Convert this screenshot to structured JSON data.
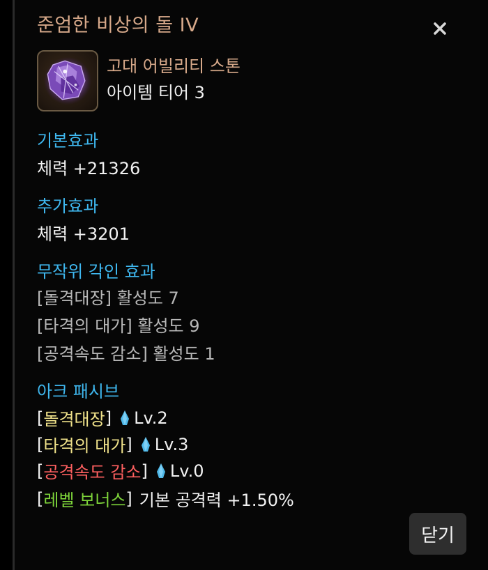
{
  "title": "준엄한 비상의 돌 IV",
  "colors": {
    "title": "#d7a98a",
    "section": "#3fb8f0",
    "engrave_yellow": "#f0e28a",
    "engrave_red": "#ff6060",
    "bonus_green": "#7ed43a",
    "gem": "#4fb8e8"
  },
  "icons": {
    "close": "close-icon",
    "item": "ability-stone-icon",
    "gem": "gem-icon"
  },
  "item": {
    "type": "고대 어빌리티 스톤",
    "tier": "아이템 티어 3"
  },
  "basic_effect": {
    "heading": "기본효과",
    "value": "체력 +21326"
  },
  "extra_effect": {
    "heading": "추가효과",
    "value": "체력 +3201"
  },
  "random_engraving": {
    "heading": "무작위 각인 효과",
    "lines": [
      "[돌격대장] 활성도 7",
      "[타격의 대가] 활성도 9",
      "[공격속도 감소] 활성도 1"
    ]
  },
  "ark_passive": {
    "heading": "아크 패시브",
    "entries": [
      {
        "name": "돌격대장",
        "level": "Lv.2"
      },
      {
        "name": "타격의 대가",
        "level": "Lv.3"
      },
      {
        "name": "공격속도 감소",
        "level": "Lv.0"
      }
    ],
    "bonus": {
      "name": "레벨 보너스",
      "text": "기본 공격력 +1.50%"
    }
  },
  "close_label": "닫기"
}
